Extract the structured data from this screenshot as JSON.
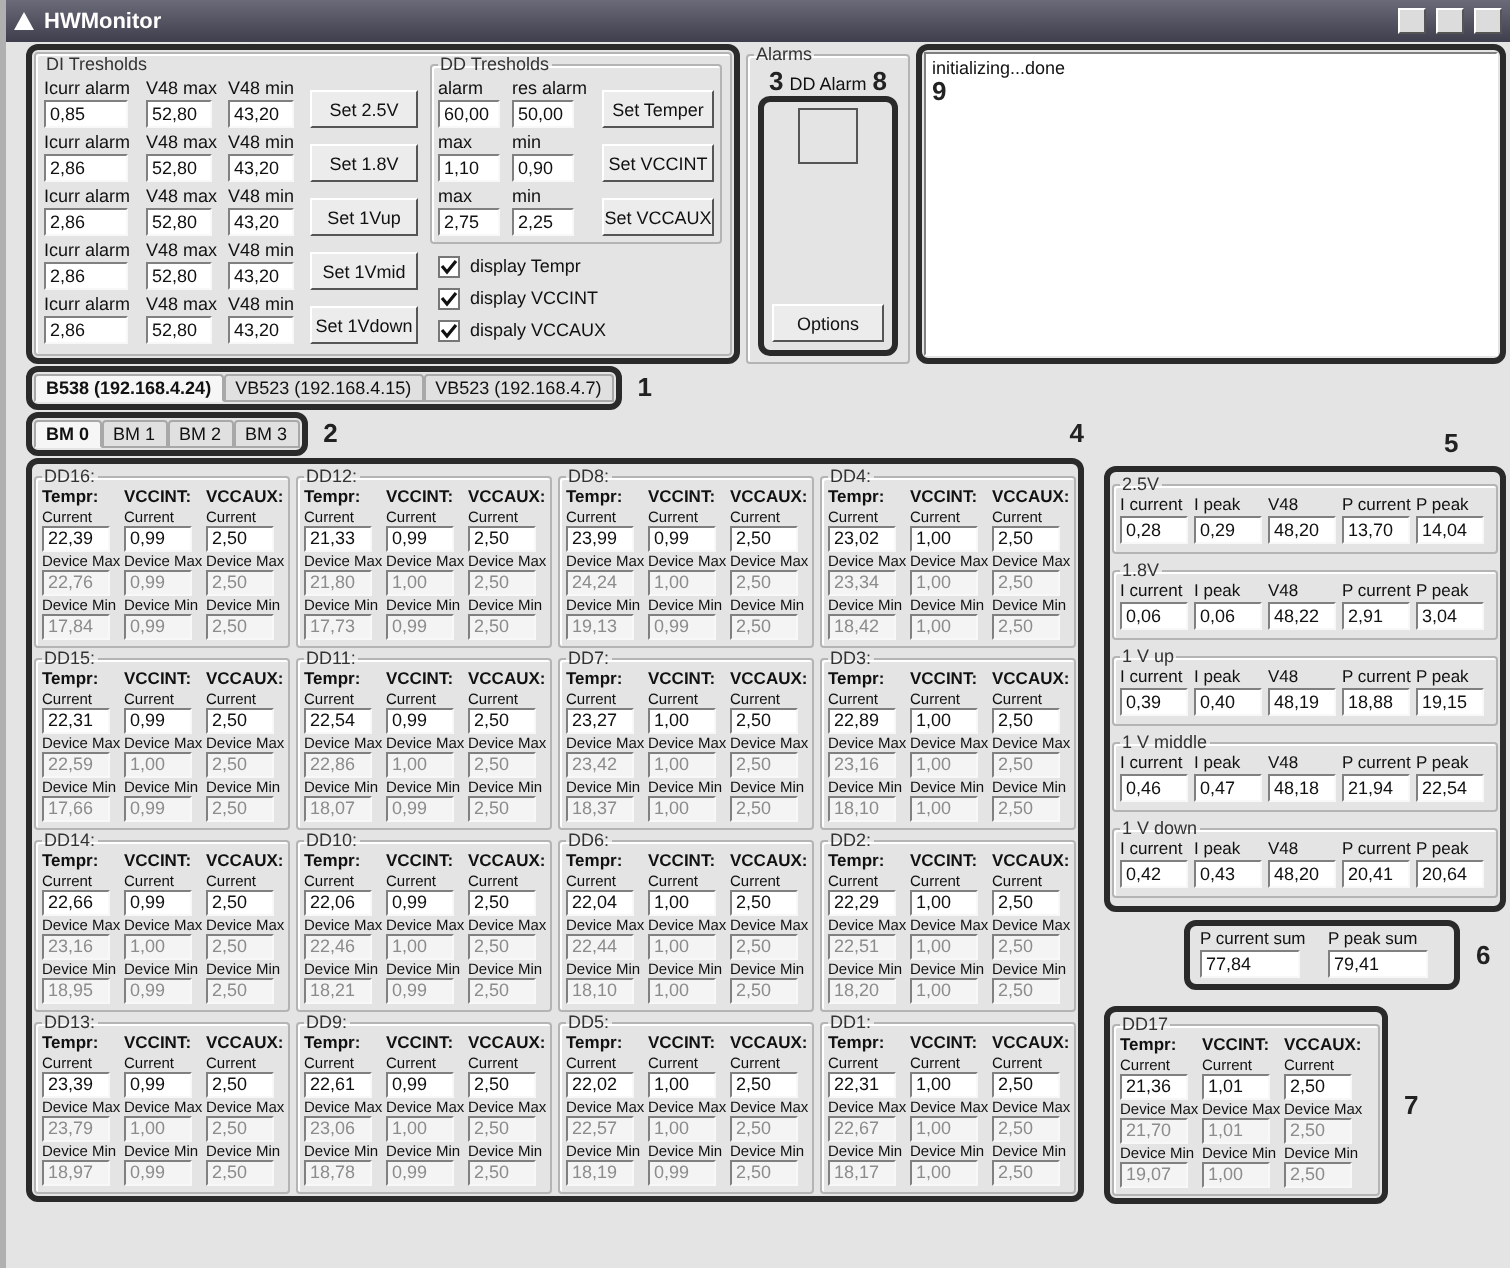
{
  "window": {
    "title": "HWMonitor"
  },
  "di_thresholds": {
    "title": "DI Tresholds",
    "rows": [
      {
        "labels": [
          "Icurr alarm",
          "V48 max",
          "V48 min"
        ],
        "values": [
          "0,85",
          "52,80",
          "43,20"
        ],
        "button": "Set 2.5V"
      },
      {
        "labels": [
          "Icurr alarm",
          "V48 max",
          "V48 min"
        ],
        "values": [
          "2,86",
          "52,80",
          "43,20"
        ],
        "button": "Set 1.8V"
      },
      {
        "labels": [
          "Icurr alarm",
          "V48 max",
          "V48 min"
        ],
        "values": [
          "2,86",
          "52,80",
          "43,20"
        ],
        "button": "Set 1Vup"
      },
      {
        "labels": [
          "Icurr alarm",
          "V48 max",
          "V48 min"
        ],
        "values": [
          "2,86",
          "52,80",
          "43,20"
        ],
        "button": "Set 1Vmid"
      },
      {
        "labels": [
          "Icurr alarm",
          "V48 max",
          "V48 min"
        ],
        "values": [
          "2,86",
          "52,80",
          "43,20"
        ],
        "button": "Set 1Vdown"
      }
    ]
  },
  "dd_thresholds": {
    "title": "DD Tresholds",
    "rows": [
      {
        "labels": [
          "alarm",
          "res alarm"
        ],
        "values": [
          "60,00",
          "50,00"
        ],
        "button": "Set Temper"
      },
      {
        "labels": [
          "max",
          "min"
        ],
        "values": [
          "1,10",
          "0,90"
        ],
        "button": "Set VCCINT"
      },
      {
        "labels": [
          "max",
          "min"
        ],
        "values": [
          "2,75",
          "2,25"
        ],
        "button": "Set VCCAUX"
      }
    ]
  },
  "display_options": [
    {
      "label": "display Tempr",
      "checked": true
    },
    {
      "label": "display VCCINT",
      "checked": true
    },
    {
      "label": "dispaly VCCAUX",
      "checked": true
    }
  ],
  "alarms": {
    "title": "Alarms",
    "label": "DD Alarm",
    "button": "Options"
  },
  "log": {
    "text": "initializing...done"
  },
  "device_tabs": [
    {
      "label": "B538 (192.168.4.24)",
      "selected": true
    },
    {
      "label": "VB523 (192.168.4.15)",
      "selected": false
    },
    {
      "label": "VB523 (192.168.4.7)",
      "selected": false
    }
  ],
  "board_tabs": [
    {
      "label": "BM 0",
      "selected": true
    },
    {
      "label": "BM 1",
      "selected": false
    },
    {
      "label": "BM 2",
      "selected": false
    },
    {
      "label": "BM 3",
      "selected": false
    }
  ],
  "dd_groups": [
    {
      "title": "DD16:",
      "headers": [
        "Tempr:",
        "VCCINT:",
        "VCCAUX:"
      ],
      "rows": [
        {
          "labels": [
            "Current",
            "Current",
            "Current"
          ],
          "values": [
            "22,39",
            "0,99",
            "2,50"
          ],
          "disabled": false
        },
        {
          "labels": [
            "Device Max",
            "Device Max",
            "Device Max"
          ],
          "values": [
            "22,76",
            "0,99",
            "2,50"
          ],
          "disabled": true
        },
        {
          "labels": [
            "Device Min",
            "Device Min",
            "Device Min"
          ],
          "values": [
            "17,84",
            "0,99",
            "2,50"
          ],
          "disabled": true
        }
      ]
    },
    {
      "title": "DD12:",
      "headers": [
        "Tempr:",
        "VCCINT:",
        "VCCAUX:"
      ],
      "rows": [
        {
          "labels": [
            "Current",
            "Current",
            "Current"
          ],
          "values": [
            "21,33",
            "0,99",
            "2,50"
          ],
          "disabled": false
        },
        {
          "labels": [
            "Device Max",
            "Device Max",
            "Device Max"
          ],
          "values": [
            "21,80",
            "1,00",
            "2,50"
          ],
          "disabled": true
        },
        {
          "labels": [
            "Device Min",
            "Device Min",
            "Device Min"
          ],
          "values": [
            "17,73",
            "0,99",
            "2,50"
          ],
          "disabled": true
        }
      ]
    },
    {
      "title": "DD8:",
      "headers": [
        "Tempr:",
        "VCCINT:",
        "VCCAUX:"
      ],
      "rows": [
        {
          "labels": [
            "Current",
            "Current",
            "Current"
          ],
          "values": [
            "23,99",
            "0,99",
            "2,50"
          ],
          "disabled": false
        },
        {
          "labels": [
            "Device Max",
            "Device Max",
            "Device Max"
          ],
          "values": [
            "24,24",
            "1,00",
            "2,50"
          ],
          "disabled": true
        },
        {
          "labels": [
            "Device Min",
            "Device Min",
            "Device Min"
          ],
          "values": [
            "19,13",
            "0,99",
            "2,50"
          ],
          "disabled": true
        }
      ]
    },
    {
      "title": "DD4:",
      "headers": [
        "Tempr:",
        "VCCINT:",
        "VCCAUX:"
      ],
      "rows": [
        {
          "labels": [
            "Current",
            "Current",
            "Current"
          ],
          "values": [
            "23,02",
            "1,00",
            "2,50"
          ],
          "disabled": false
        },
        {
          "labels": [
            "Device Max",
            "Device Max",
            "Device Max"
          ],
          "values": [
            "23,34",
            "1,00",
            "2,50"
          ],
          "disabled": true
        },
        {
          "labels": [
            "Device Min",
            "Device Min",
            "Device Min"
          ],
          "values": [
            "18,42",
            "1,00",
            "2,50"
          ],
          "disabled": true
        }
      ]
    },
    {
      "title": "DD15:",
      "headers": [
        "Tempr:",
        "VCCINT:",
        "VCCAUX:"
      ],
      "rows": [
        {
          "labels": [
            "Current",
            "Current",
            "Current"
          ],
          "values": [
            "22,31",
            "0,99",
            "2,50"
          ],
          "disabled": false
        },
        {
          "labels": [
            "Device Max",
            "Device Max",
            "Device Max"
          ],
          "values": [
            "22,59",
            "1,00",
            "2,50"
          ],
          "disabled": true
        },
        {
          "labels": [
            "Device Min",
            "Device Min",
            "Device Min"
          ],
          "values": [
            "17,66",
            "0,99",
            "2,50"
          ],
          "disabled": true
        }
      ]
    },
    {
      "title": "DD11:",
      "headers": [
        "Tempr:",
        "VCCINT:",
        "VCCAUX:"
      ],
      "rows": [
        {
          "labels": [
            "Current",
            "Current",
            "Current"
          ],
          "values": [
            "22,54",
            "0,99",
            "2,50"
          ],
          "disabled": false
        },
        {
          "labels": [
            "Device Max",
            "Device Max",
            "Device Max"
          ],
          "values": [
            "22,86",
            "1,00",
            "2,50"
          ],
          "disabled": true
        },
        {
          "labels": [
            "Device Min",
            "Device Min",
            "Device Min"
          ],
          "values": [
            "18,07",
            "0,99",
            "2,50"
          ],
          "disabled": true
        }
      ]
    },
    {
      "title": "DD7:",
      "headers": [
        "Tempr:",
        "VCCINT:",
        "VCCAUX:"
      ],
      "rows": [
        {
          "labels": [
            "Current",
            "Current",
            "Current"
          ],
          "values": [
            "23,27",
            "1,00",
            "2,50"
          ],
          "disabled": false
        },
        {
          "labels": [
            "Device Max",
            "Device Max",
            "Device Max"
          ],
          "values": [
            "23,42",
            "1,00",
            "2,50"
          ],
          "disabled": true
        },
        {
          "labels": [
            "Device Min",
            "Device Min",
            "Device Min"
          ],
          "values": [
            "18,37",
            "1,00",
            "2,50"
          ],
          "disabled": true
        }
      ]
    },
    {
      "title": "DD3:",
      "headers": [
        "Tempr:",
        "VCCINT:",
        "VCCAUX:"
      ],
      "rows": [
        {
          "labels": [
            "Current",
            "Current",
            "Current"
          ],
          "values": [
            "22,89",
            "1,00",
            "2,50"
          ],
          "disabled": false
        },
        {
          "labels": [
            "Device Max",
            "Device Max",
            "Device Max"
          ],
          "values": [
            "23,16",
            "1,00",
            "2,50"
          ],
          "disabled": true
        },
        {
          "labels": [
            "Device Min",
            "Device Min",
            "Device Min"
          ],
          "values": [
            "18,10",
            "1,00",
            "2,50"
          ],
          "disabled": true
        }
      ]
    },
    {
      "title": "DD14:",
      "headers": [
        "Tempr:",
        "VCCINT:",
        "VCCAUX:"
      ],
      "rows": [
        {
          "labels": [
            "Current",
            "Current",
            "Current"
          ],
          "values": [
            "22,66",
            "0,99",
            "2,50"
          ],
          "disabled": false
        },
        {
          "labels": [
            "Device Max",
            "Device Max",
            "Device Max"
          ],
          "values": [
            "23,16",
            "1,00",
            "2,50"
          ],
          "disabled": true
        },
        {
          "labels": [
            "Device Min",
            "Device Min",
            "Device Min"
          ],
          "values": [
            "18,95",
            "0,99",
            "2,50"
          ],
          "disabled": true
        }
      ]
    },
    {
      "title": "DD10:",
      "headers": [
        "Tempr:",
        "VCCINT:",
        "VCCAUX:"
      ],
      "rows": [
        {
          "labels": [
            "Current",
            "Current",
            "Current"
          ],
          "values": [
            "22,06",
            "0,99",
            "2,50"
          ],
          "disabled": false
        },
        {
          "labels": [
            "Device Max",
            "Device Max",
            "Device Max"
          ],
          "values": [
            "22,46",
            "1,00",
            "2,50"
          ],
          "disabled": true
        },
        {
          "labels": [
            "Device Min",
            "Device Min",
            "Device Min"
          ],
          "values": [
            "18,21",
            "0,99",
            "2,50"
          ],
          "disabled": true
        }
      ]
    },
    {
      "title": "DD6:",
      "headers": [
        "Tempr:",
        "VCCINT:",
        "VCCAUX:"
      ],
      "rows": [
        {
          "labels": [
            "Current",
            "Current",
            "Current"
          ],
          "values": [
            "22,04",
            "1,00",
            "2,50"
          ],
          "disabled": false
        },
        {
          "labels": [
            "Device Max",
            "Device Max",
            "Device Max"
          ],
          "values": [
            "22,44",
            "1,00",
            "2,50"
          ],
          "disabled": true
        },
        {
          "labels": [
            "Device Min",
            "Device Min",
            "Device Min"
          ],
          "values": [
            "18,10",
            "1,00",
            "2,50"
          ],
          "disabled": true
        }
      ]
    },
    {
      "title": "DD2:",
      "headers": [
        "Tempr:",
        "VCCINT:",
        "VCCAUX:"
      ],
      "rows": [
        {
          "labels": [
            "Current",
            "Current",
            "Current"
          ],
          "values": [
            "22,29",
            "1,00",
            "2,50"
          ],
          "disabled": false
        },
        {
          "labels": [
            "Device Max",
            "Device Max",
            "Device Max"
          ],
          "values": [
            "22,51",
            "1,00",
            "2,50"
          ],
          "disabled": true
        },
        {
          "labels": [
            "Device Min",
            "Device Min",
            "Device Min"
          ],
          "values": [
            "18,20",
            "1,00",
            "2,50"
          ],
          "disabled": true
        }
      ]
    },
    {
      "title": "DD13:",
      "headers": [
        "Tempr:",
        "VCCINT:",
        "VCCAUX:"
      ],
      "rows": [
        {
          "labels": [
            "Current",
            "Current",
            "Current"
          ],
          "values": [
            "23,39",
            "0,99",
            "2,50"
          ],
          "disabled": false
        },
        {
          "labels": [
            "Device Max",
            "Device Max",
            "Device Max"
          ],
          "values": [
            "23,79",
            "1,00",
            "2,50"
          ],
          "disabled": true
        },
        {
          "labels": [
            "Device Min",
            "Device Min",
            "Device Min"
          ],
          "values": [
            "18,97",
            "0,99",
            "2,50"
          ],
          "disabled": true
        }
      ]
    },
    {
      "title": "DD9:",
      "headers": [
        "Tempr:",
        "VCCINT:",
        "VCCAUX:"
      ],
      "rows": [
        {
          "labels": [
            "Current",
            "Current",
            "Current"
          ],
          "values": [
            "22,61",
            "0,99",
            "2,50"
          ],
          "disabled": false
        },
        {
          "labels": [
            "Device Max",
            "Device Max",
            "Device Max"
          ],
          "values": [
            "23,06",
            "1,00",
            "2,50"
          ],
          "disabled": true
        },
        {
          "labels": [
            "Device Min",
            "Device Min",
            "Device Min"
          ],
          "values": [
            "18,78",
            "0,99",
            "2,50"
          ],
          "disabled": true
        }
      ]
    },
    {
      "title": "DD5:",
      "headers": [
        "Tempr:",
        "VCCINT:",
        "VCCAUX:"
      ],
      "rows": [
        {
          "labels": [
            "Current",
            "Current",
            "Current"
          ],
          "values": [
            "22,02",
            "1,00",
            "2,50"
          ],
          "disabled": false
        },
        {
          "labels": [
            "Device Max",
            "Device Max",
            "Device Max"
          ],
          "values": [
            "22,57",
            "1,00",
            "2,50"
          ],
          "disabled": true
        },
        {
          "labels": [
            "Device Min",
            "Device Min",
            "Device Min"
          ],
          "values": [
            "18,19",
            "0,99",
            "2,50"
          ],
          "disabled": true
        }
      ]
    },
    {
      "title": "DD1:",
      "headers": [
        "Tempr:",
        "VCCINT:",
        "VCCAUX:"
      ],
      "rows": [
        {
          "labels": [
            "Current",
            "Current",
            "Current"
          ],
          "values": [
            "22,31",
            "1,00",
            "2,50"
          ],
          "disabled": false
        },
        {
          "labels": [
            "Device Max",
            "Device Max",
            "Device Max"
          ],
          "values": [
            "22,67",
            "1,00",
            "2,50"
          ],
          "disabled": true
        },
        {
          "labels": [
            "Device Min",
            "Device Min",
            "Device Min"
          ],
          "values": [
            "18,17",
            "1,00",
            "2,50"
          ],
          "disabled": true
        }
      ]
    }
  ],
  "power_groups": [
    {
      "title": "2.5V",
      "labels": [
        "I current",
        "I peak",
        "V48",
        "P current",
        "P peak"
      ],
      "values": [
        "0,28",
        "0,29",
        "48,20",
        "13,70",
        "14,04"
      ]
    },
    {
      "title": "1.8V",
      "labels": [
        "I current",
        "I peak",
        "V48",
        "P current",
        "P peak"
      ],
      "values": [
        "0,06",
        "0,06",
        "48,22",
        "2,91",
        "3,04"
      ]
    },
    {
      "title": "1 V up",
      "labels": [
        "I current",
        "I peak",
        "V48",
        "P current",
        "P peak"
      ],
      "values": [
        "0,39",
        "0,40",
        "48,19",
        "18,88",
        "19,15"
      ]
    },
    {
      "title": "1 V middle",
      "labels": [
        "I current",
        "I peak",
        "V48",
        "P current",
        "P peak"
      ],
      "values": [
        "0,46",
        "0,47",
        "48,18",
        "21,94",
        "22,54"
      ]
    },
    {
      "title": "1 V down",
      "labels": [
        "I current",
        "I peak",
        "V48",
        "P current",
        "P peak"
      ],
      "values": [
        "0,42",
        "0,43",
        "48,20",
        "20,41",
        "20,64"
      ]
    }
  ],
  "power_sum": {
    "labels": [
      "P current sum",
      "P peak sum"
    ],
    "values": [
      "77,84",
      "79,41"
    ]
  },
  "dd17": {
    "title": "DD17",
    "headers": [
      "Tempr:",
      "VCCINT:",
      "VCCAUX:"
    ],
    "rows": [
      {
        "labels": [
          "Current",
          "Current",
          "Current"
        ],
        "values": [
          "21,36",
          "1,01",
          "2,50"
        ],
        "disabled": false
      },
      {
        "labels": [
          "Device Max",
          "Device Max",
          "Device Max"
        ],
        "values": [
          "21,70",
          "1,01",
          "2,50"
        ],
        "disabled": true
      },
      {
        "labels": [
          "Device Min",
          "Device Min",
          "Device Min"
        ],
        "values": [
          "19,07",
          "1,00",
          "2,50"
        ],
        "disabled": true
      }
    ]
  },
  "callouts": [
    "1",
    "2",
    "3",
    "4",
    "5",
    "6",
    "7",
    "8",
    "9"
  ]
}
